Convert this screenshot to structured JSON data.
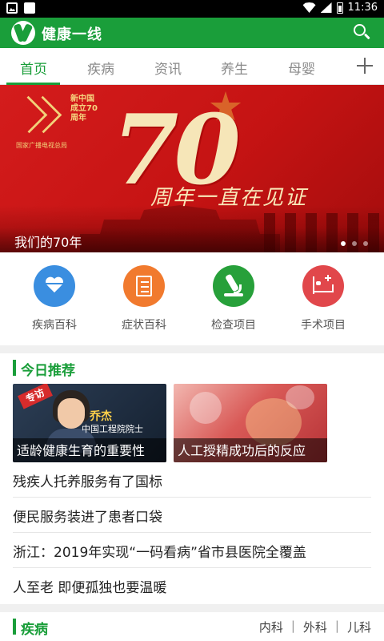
{
  "status_bar": {
    "time": "11:36"
  },
  "app": {
    "title": "健康一线"
  },
  "tabs": [
    {
      "label": "首页",
      "active": true
    },
    {
      "label": "疾病"
    },
    {
      "label": "资讯"
    },
    {
      "label": "养生"
    },
    {
      "label": "母婴"
    }
  ],
  "banner": {
    "caption": "我们的70年",
    "emblem_text": "新中国成立70周年",
    "emblem_sub": "国家广播电视总局",
    "big_number": "70",
    "slogan": "周年一直在见证",
    "slide_count": 3,
    "active_slide": 1
  },
  "quick_entries": [
    {
      "label": "疾病百科",
      "icon": "heart-pulse-icon",
      "color": "#3a8ee0"
    },
    {
      "label": "症状百科",
      "icon": "clipboard-icon",
      "color": "#f17a2e"
    },
    {
      "label": "检查项目",
      "icon": "microscope-icon",
      "color": "#27a03a"
    },
    {
      "label": "手术项目",
      "icon": "hospital-bed-icon",
      "color": "#e1474b"
    }
  ],
  "recommend": {
    "title": "今日推荐",
    "cards": [
      {
        "title": "适龄健康生育的重要性",
        "tag": "专访",
        "person_name": "乔杰",
        "person_title": "中国工程院院士"
      },
      {
        "title": "人工授精成功后的反应"
      }
    ],
    "news": [
      "残疾人托养服务有了国标",
      "便民服务装进了患者口袋",
      "浙江：2019年实现“一码看病”省市县医院全覆盖",
      "人至老 即便孤独也要温暖"
    ]
  },
  "disease_section": {
    "title": "疾病",
    "links": [
      "内科",
      "外科",
      "儿科"
    ]
  },
  "colors": {
    "brand_green": "#1a9e3a",
    "banner_red": "#c51313"
  }
}
